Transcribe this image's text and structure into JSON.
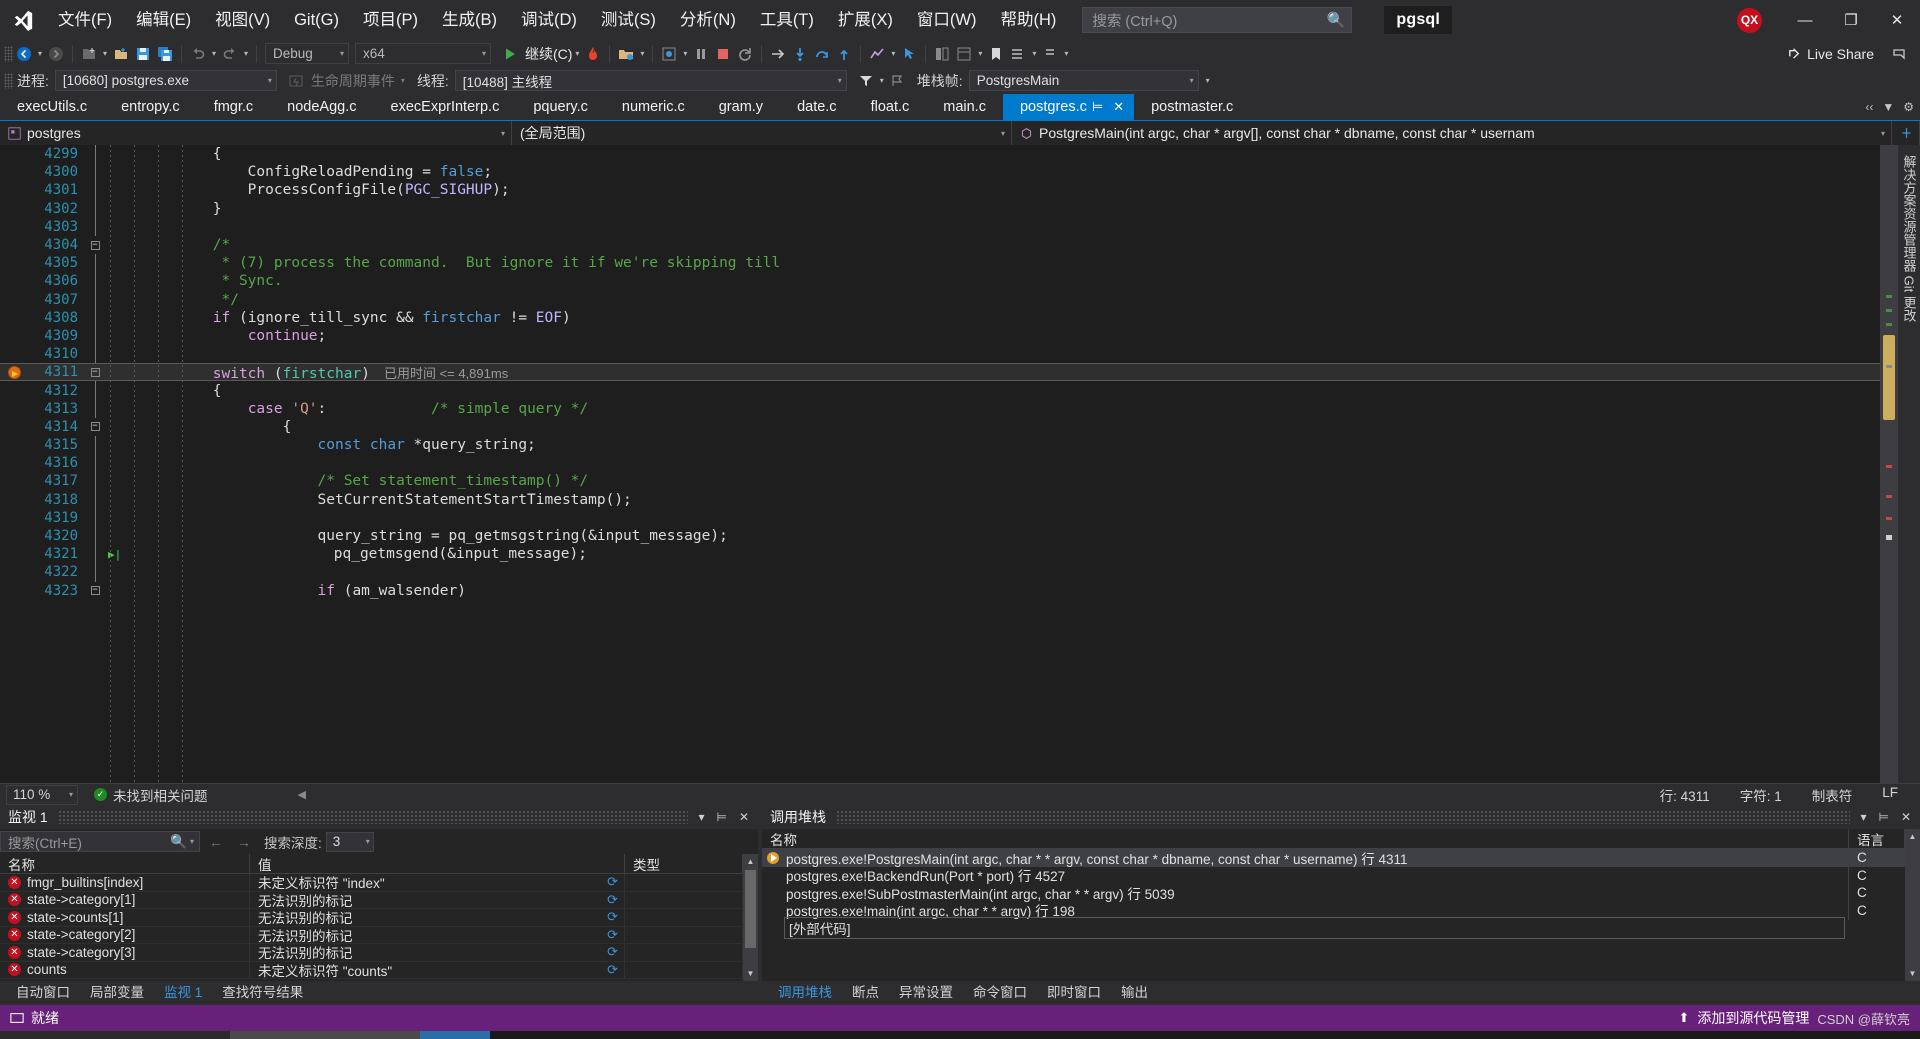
{
  "window": {
    "project_badge": "pgsql",
    "avatar_initials": "QX",
    "minimize": "—",
    "maximize": "❐",
    "close": "✕"
  },
  "search": {
    "placeholder": "搜索 (Ctrl+Q)",
    "icon": "search-icon"
  },
  "menu": [
    {
      "label": "文件(F)"
    },
    {
      "label": "编辑(E)"
    },
    {
      "label": "视图(V)"
    },
    {
      "label": "Git(G)"
    },
    {
      "label": "项目(P)"
    },
    {
      "label": "生成(B)"
    },
    {
      "label": "调试(D)"
    },
    {
      "label": "测试(S)"
    },
    {
      "label": "分析(N)"
    },
    {
      "label": "工具(T)"
    },
    {
      "label": "扩展(X)"
    },
    {
      "label": "窗口(W)"
    },
    {
      "label": "帮助(H)"
    }
  ],
  "toolbar": {
    "config": "Debug",
    "platform": "x64",
    "continue_label": "继续(C)",
    "live_share": "Live Share",
    "icons": [
      "navigate-back-icon",
      "navigate-forward-icon",
      "new-item-icon",
      "open-file-icon",
      "save-icon",
      "save-all-icon",
      "undo-icon",
      "redo-icon",
      "start-debug-icon",
      "hot-reload-icon",
      "attach-process-icon",
      "breakpoint-window-icon",
      "pause-icon",
      "stop-icon",
      "restart-icon",
      "step-over-icon",
      "step-into-icon",
      "step-out-cycle-icon",
      "step-out-icon",
      "diagnostics-icon",
      "pointer-icon",
      "compare-icon",
      "solution-icon",
      "bookmark-icon",
      "expand-icon",
      "collapse-icon"
    ]
  },
  "process_bar": {
    "process_label": "进程:",
    "process_value": "[10680] postgres.exe",
    "lifecycle_events": "生命周期事件",
    "thread_label": "线程:",
    "thread_value": "[10488] 主线程",
    "stackframe_label": "堆栈帧:",
    "stackframe_value": "PostgresMain"
  },
  "tabs": [
    {
      "label": "execUtils.c",
      "active": false
    },
    {
      "label": "entropy.c",
      "active": false
    },
    {
      "label": "fmgr.c",
      "active": false
    },
    {
      "label": "nodeAgg.c",
      "active": false
    },
    {
      "label": "execExprInterp.c",
      "active": false
    },
    {
      "label": "pquery.c",
      "active": false
    },
    {
      "label": "numeric.c",
      "active": false
    },
    {
      "label": "gram.y",
      "active": false
    },
    {
      "label": "date.c",
      "active": false
    },
    {
      "label": "float.c",
      "active": false
    },
    {
      "label": "main.c",
      "active": false
    },
    {
      "label": "postgres.c",
      "active": true
    },
    {
      "label": "postmaster.c",
      "active": false
    }
  ],
  "navbar": {
    "project": "postgres",
    "scope": "(全局范围)",
    "member": "PostgresMain(int argc, char * argv[], const char * dbname, const char * usernam"
  },
  "side_rail": {
    "label": "解决方案资源管理器   Git 更改"
  },
  "code": {
    "lines": [
      {
        "n": "4299",
        "fold": "",
        "tokens": [
          {
            "t": "            {",
            "c": "pl"
          }
        ]
      },
      {
        "n": "4300",
        "fold": "",
        "tokens": [
          {
            "t": "                ConfigReloadPending = ",
            "c": "pl"
          },
          {
            "t": "false",
            "c": "k"
          },
          {
            "t": ";",
            "c": "pl"
          }
        ]
      },
      {
        "n": "4301",
        "fold": "",
        "tokens": [
          {
            "t": "                ProcessConfigFile(",
            "c": "pl"
          },
          {
            "t": "PGC_SIGHUP",
            "c": "mc"
          },
          {
            "t": ");",
            "c": "pl"
          }
        ]
      },
      {
        "n": "4302",
        "fold": "",
        "tokens": [
          {
            "t": "            }",
            "c": "pl"
          }
        ]
      },
      {
        "n": "4303",
        "fold": "",
        "tokens": []
      },
      {
        "n": "4304",
        "fold": "minus",
        "tokens": [
          {
            "t": "            /*",
            "c": "cm"
          }
        ]
      },
      {
        "n": "4305",
        "fold": "",
        "tokens": [
          {
            "t": "             * (7) process the command.  But ignore it if we're skipping till",
            "c": "cm"
          }
        ]
      },
      {
        "n": "4306",
        "fold": "",
        "tokens": [
          {
            "t": "             * Sync.",
            "c": "cm"
          }
        ]
      },
      {
        "n": "4307",
        "fold": "",
        "tokens": [
          {
            "t": "             */",
            "c": "cm"
          }
        ]
      },
      {
        "n": "4308",
        "fold": "",
        "tokens": [
          {
            "t": "            ",
            "c": "pl"
          },
          {
            "t": "if",
            "c": "kc"
          },
          {
            "t": " (ignore_till_sync && ",
            "c": "pl"
          },
          {
            "t": "firstchar",
            "c": "k"
          },
          {
            "t": " != ",
            "c": "pl"
          },
          {
            "t": "EOF",
            "c": "mc"
          },
          {
            "t": ")",
            "c": "pl"
          }
        ]
      },
      {
        "n": "4309",
        "fold": "",
        "tokens": [
          {
            "t": "                ",
            "c": "pl"
          },
          {
            "t": "continue",
            "c": "kc"
          },
          {
            "t": ";",
            "c": "pl"
          }
        ]
      },
      {
        "n": "4310",
        "fold": "",
        "tokens": []
      },
      {
        "n": "4311",
        "fold": "minus",
        "breakpoint": true,
        "current": true,
        "tokens": [
          {
            "t": "            ",
            "c": "pl"
          },
          {
            "t": "switch",
            "c": "kc"
          },
          {
            "t": " (",
            "c": "pl"
          },
          {
            "t": "firstchar",
            "c": "ty"
          },
          {
            "t": ")",
            "c": "pl"
          }
        ],
        "elapsed": "已用时间 <= 4,891ms"
      },
      {
        "n": "4312",
        "fold": "",
        "tokens": [
          {
            "t": "            {",
            "c": "pl"
          }
        ]
      },
      {
        "n": "4313",
        "fold": "",
        "tokens": [
          {
            "t": "                ",
            "c": "pl"
          },
          {
            "t": "case",
            "c": "kc"
          },
          {
            "t": " ",
            "c": "pl"
          },
          {
            "t": "'Q'",
            "c": "st"
          },
          {
            "t": ":",
            "c": "pl"
          },
          {
            "t": "            /* simple query */",
            "c": "cm"
          }
        ]
      },
      {
        "n": "4314",
        "fold": "minus",
        "tokens": [
          {
            "t": "                    {",
            "c": "pl"
          }
        ]
      },
      {
        "n": "4315",
        "fold": "",
        "tokens": [
          {
            "t": "                        ",
            "c": "pl"
          },
          {
            "t": "const",
            "c": "k"
          },
          {
            "t": " ",
            "c": "pl"
          },
          {
            "t": "char",
            "c": "k"
          },
          {
            "t": " *query_string;",
            "c": "pl"
          }
        ]
      },
      {
        "n": "4316",
        "fold": "",
        "tokens": []
      },
      {
        "n": "4317",
        "fold": "",
        "tokens": [
          {
            "t": "                        /* Set statement_timestamp() */",
            "c": "cm"
          }
        ]
      },
      {
        "n": "4318",
        "fold": "",
        "tokens": [
          {
            "t": "                        SetCurrentStatementStartTimestamp();",
            "c": "pl"
          }
        ]
      },
      {
        "n": "4319",
        "fold": "",
        "tokens": []
      },
      {
        "n": "4320",
        "fold": "",
        "tokens": [
          {
            "t": "                        query_string = pq_getmsgstring(&input_message);",
            "c": "pl"
          }
        ]
      },
      {
        "n": "4321",
        "fold": "",
        "step": true,
        "tokens": [
          {
            "t": "                        pq_getmsgend(&input_message);",
            "c": "pl"
          }
        ]
      },
      {
        "n": "4322",
        "fold": "",
        "tokens": []
      },
      {
        "n": "4323",
        "fold": "minus",
        "tokens": [
          {
            "t": "                        ",
            "c": "pl"
          },
          {
            "t": "if",
            "c": "kc"
          },
          {
            "t": " (am_walsender)",
            "c": "pl"
          }
        ]
      }
    ]
  },
  "editor_status": {
    "zoom": "110 %",
    "problems": "未找到相关问题",
    "line": "行: 4311",
    "col": "字符: 1",
    "tabs_mode": "制表符",
    "eol": "LF"
  },
  "watch_panel": {
    "title": "监视 1",
    "search_placeholder": "搜索(Ctrl+E)",
    "depth_label": "搜索深度:",
    "depth_value": "3",
    "columns": [
      "名称",
      "值",
      "类型"
    ],
    "rows": [
      {
        "name": "fmgr_builtins[index]",
        "value": "未定义标识符 \"index\"",
        "type": ""
      },
      {
        "name": "state->category[1]",
        "value": "无法识别的标记",
        "type": ""
      },
      {
        "name": "state->counts[1]",
        "value": "无法识别的标记",
        "type": ""
      },
      {
        "name": "state->category[2]",
        "value": "无法识别的标记",
        "type": ""
      },
      {
        "name": "state->category[3]",
        "value": "无法识别的标记",
        "type": ""
      },
      {
        "name": "counts",
        "value": "未定义标识符 \"counts\"",
        "type": ""
      }
    ],
    "tabs": [
      {
        "label": "自动窗口",
        "active": false
      },
      {
        "label": "局部变量",
        "active": false
      },
      {
        "label": "监视 1",
        "active": true
      },
      {
        "label": "查找符号结果",
        "active": false
      }
    ]
  },
  "callstack_panel": {
    "title": "调用堆栈",
    "columns": [
      "名称",
      "语言"
    ],
    "rows": [
      {
        "marker": "arrow",
        "name": "postgres.exe!PostgresMain(int argc, char * * argv, const char * dbname, const char * username) 行 4311",
        "lang": "C",
        "active": true
      },
      {
        "marker": "",
        "name": "postgres.exe!BackendRun(Port * port) 行 4527",
        "lang": "C",
        "active": false
      },
      {
        "marker": "",
        "name": "postgres.exe!SubPostmasterMain(int argc, char * * argv) 行 5039",
        "lang": "C",
        "active": false
      },
      {
        "marker": "",
        "name": "postgres.exe!main(int argc, char * * argv) 行 198",
        "lang": "C",
        "active": false
      },
      {
        "marker": "",
        "name": "[外部代码]",
        "lang": "",
        "active": false,
        "external": true
      }
    ],
    "tabs": [
      {
        "label": "调用堆栈",
        "active": true
      },
      {
        "label": "断点",
        "active": false
      },
      {
        "label": "异常设置",
        "active": false
      },
      {
        "label": "命令窗口",
        "active": false
      },
      {
        "label": "即时窗口",
        "active": false
      },
      {
        "label": "输出",
        "active": false
      }
    ]
  },
  "statusbar": {
    "ready": "就绪",
    "source_control": "添加到源代码管理",
    "watermark": "CSDN @薛钦亮"
  },
  "colors": {
    "accent": "#007acc",
    "status_purple": "#68217a",
    "breakpoint": "#e06c1a",
    "error_red": "#c50f1f",
    "comment_green": "#57a64a",
    "keyword_blue": "#569cd6",
    "control_magenta": "#d8a0df"
  }
}
